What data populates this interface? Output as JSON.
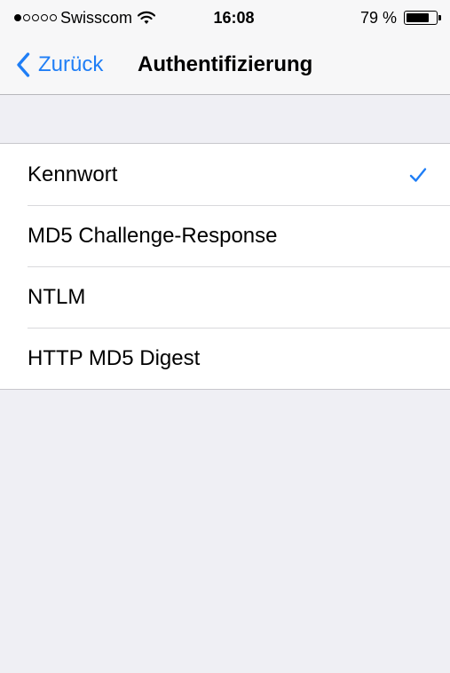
{
  "status_bar": {
    "carrier": "Swisscom",
    "signal_bars_total": 5,
    "signal_bars_filled": 1,
    "time": "16:08",
    "battery_text": "79 %",
    "battery_level": 0.79
  },
  "nav_bar": {
    "back_label": "Zurück",
    "title": "Authentifizierung"
  },
  "options": [
    {
      "label": "Kennwort",
      "selected": true
    },
    {
      "label": "MD5 Challenge-Response",
      "selected": false
    },
    {
      "label": "NTLM",
      "selected": false
    },
    {
      "label": "HTTP MD5 Digest",
      "selected": false
    }
  ],
  "colors": {
    "accent": "#1f7ef6",
    "background": "#efeff4"
  },
  "icons": {
    "back": "chevron-left-icon",
    "selected": "checkmark-icon",
    "wifi": "wifi-icon",
    "battery": "battery-icon"
  }
}
